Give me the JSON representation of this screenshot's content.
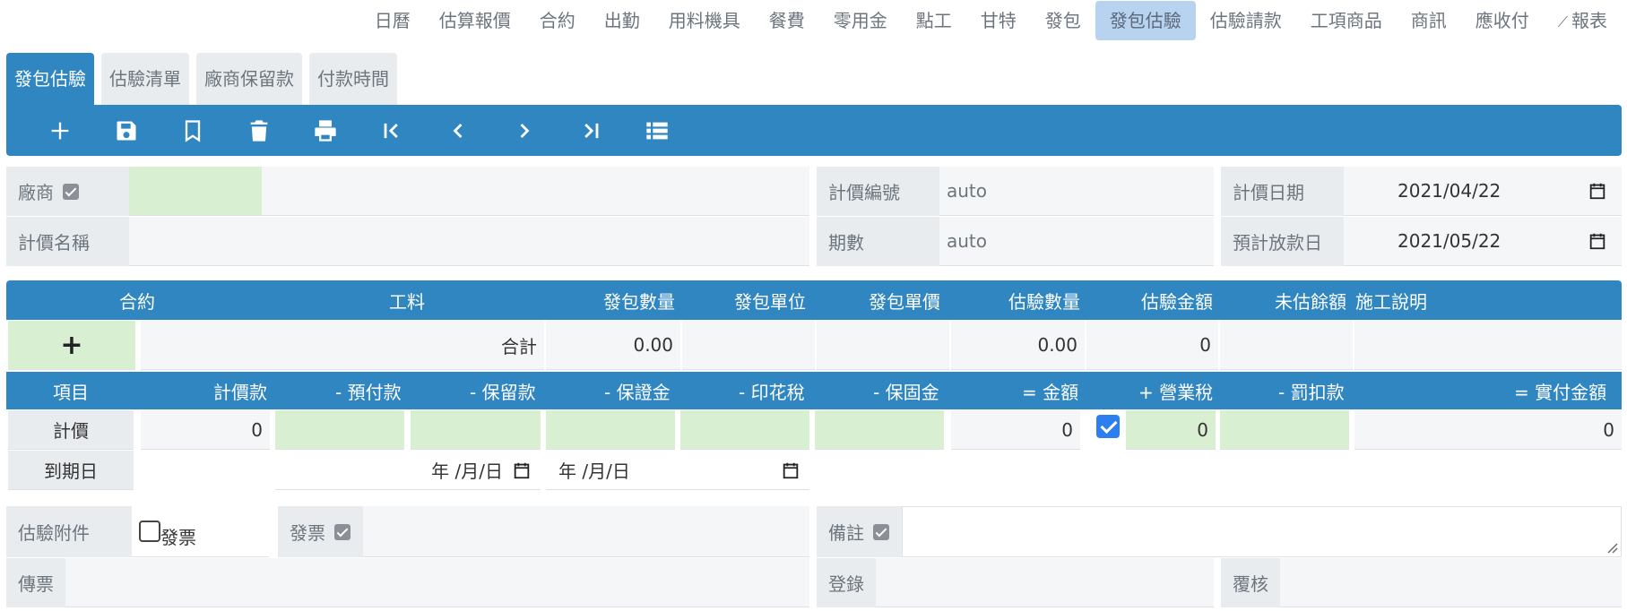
{
  "nav": [
    "日曆",
    "估算報價",
    "合約",
    "出勤",
    "用料機具",
    "餐費",
    "零用金",
    "點工",
    "甘特",
    "發包",
    "發包估驗",
    "估驗請款",
    "工項商品",
    "商訊",
    "應收付",
    "報表"
  ],
  "nav_active": "發包估驗",
  "subtabs": [
    "發包估驗",
    "估驗清單",
    "廠商保留款",
    "付款時間"
  ],
  "toolbar": [
    "plus-icon",
    "save-icon",
    "bookmark-icon",
    "trash-icon",
    "print-icon",
    "first-icon",
    "prev-icon",
    "next-icon",
    "last-icon",
    "list-icon"
  ],
  "form": {
    "vendor_label": "廠商",
    "name_label": "計價名稱",
    "code_label": "計價編號",
    "code_value": "auto",
    "period_label": "期數",
    "period_value": "auto",
    "date_label": "計價日期",
    "date_value": "2021/04/22",
    "payout_label": "預計放款日",
    "payout_value": "2021/05/22"
  },
  "items_header": [
    "合約",
    "工料",
    "發包數量",
    "發包單位",
    "發包單價",
    "估驗數量",
    "估驗金額",
    "未估餘額",
    "施工說明"
  ],
  "items_row": {
    "add": "+",
    "total_label": "合計",
    "qty": "0.00",
    "est_qty": "0.00",
    "est_amount": "0"
  },
  "pay_header": [
    "項目",
    "計價款",
    "- 預付款",
    "- 保留款",
    "- 保證金",
    "- 印花稅",
    "- 保固金",
    "= 金額",
    "+ 營業稅",
    "- 罰扣款",
    "= 實付金額"
  ],
  "pay_row": {
    "label": "計價",
    "amount": "0",
    "sum": "0",
    "tax": "0",
    "net": "0"
  },
  "due_row": {
    "label": "到期日",
    "date_placeholder": "年 /月/日"
  },
  "bottom": {
    "attach_label": "估驗附件",
    "invoice_check": "發票",
    "invoice_label": "發票",
    "note_label": "備註",
    "voucher_label": "傳票",
    "register_label": "登錄",
    "review_label": "覆核"
  },
  "colors": {
    "primary": "#2f86c1",
    "active_nav": "#b8d3ef",
    "green_input": "#d9efd2",
    "checkbox": "#2d7ff0"
  }
}
